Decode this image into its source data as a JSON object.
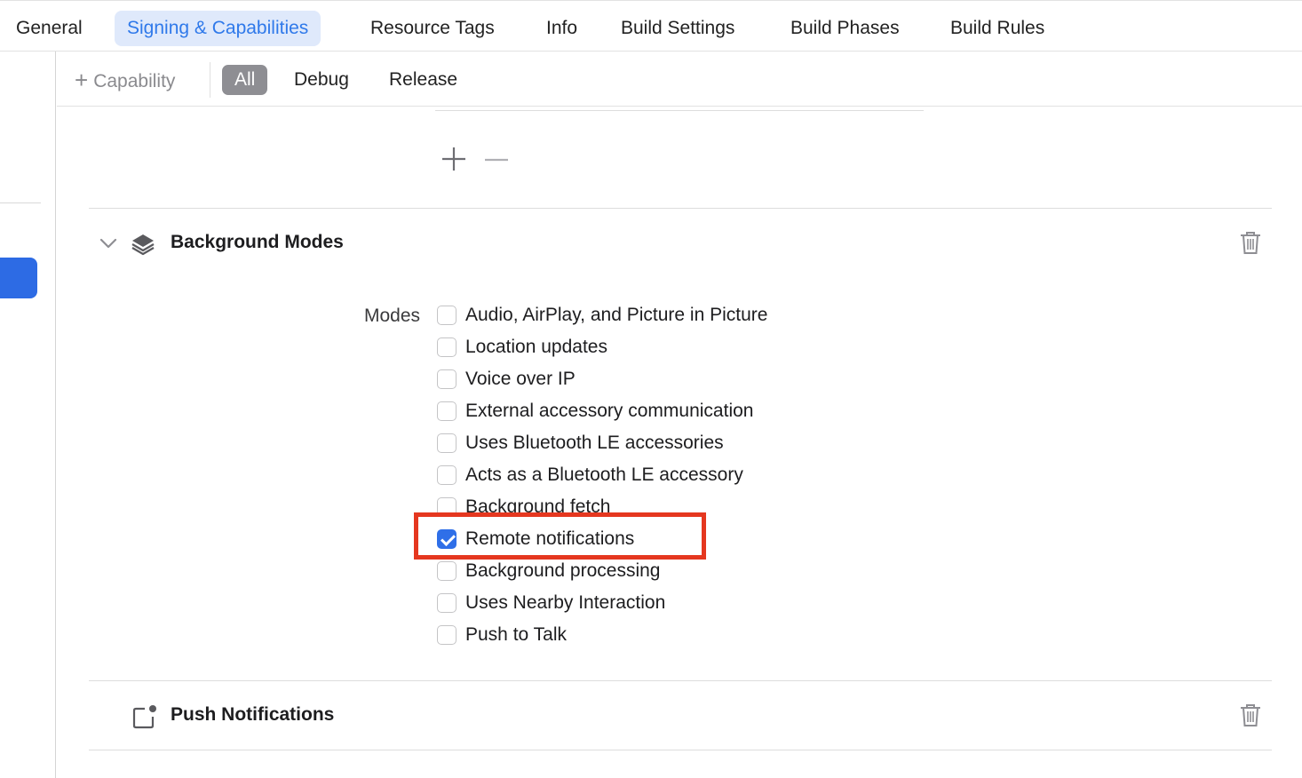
{
  "tabs": [
    {
      "label": "General",
      "active": false
    },
    {
      "label": "Signing & Capabilities",
      "active": true
    },
    {
      "label": "Resource Tags",
      "active": false
    },
    {
      "label": "Info",
      "active": false
    },
    {
      "label": "Build Settings",
      "active": false
    },
    {
      "label": "Build Phases",
      "active": false
    },
    {
      "label": "Build Rules",
      "active": false
    }
  ],
  "filter_bar": {
    "add_capability_label": "Capability",
    "segments": [
      {
        "label": "All",
        "selected": true
      },
      {
        "label": "Debug",
        "selected": false
      },
      {
        "label": "Release",
        "selected": false
      }
    ]
  },
  "background_modes": {
    "title": "Background Modes",
    "modes_label": "Modes",
    "modes": [
      {
        "label": "Audio, AirPlay, and Picture in Picture",
        "checked": false
      },
      {
        "label": "Location updates",
        "checked": false
      },
      {
        "label": "Voice over IP",
        "checked": false
      },
      {
        "label": "External accessory communication",
        "checked": false
      },
      {
        "label": "Uses Bluetooth LE accessories",
        "checked": false
      },
      {
        "label": "Acts as a Bluetooth LE accessory",
        "checked": false
      },
      {
        "label": "Background fetch",
        "checked": false
      },
      {
        "label": "Remote notifications",
        "checked": true
      },
      {
        "label": "Background processing",
        "checked": false
      },
      {
        "label": "Uses Nearby Interaction",
        "checked": false
      },
      {
        "label": "Push to Talk",
        "checked": false
      }
    ]
  },
  "push_notifications": {
    "title": "Push Notifications"
  },
  "icons": {
    "add": "plus-icon",
    "remove": "minus-icon",
    "disclosure": "chevron-down-icon",
    "background_modes": "layers-icon",
    "push_notifications": "notification-badge-icon",
    "delete": "trash-icon"
  },
  "colors": {
    "accent": "#2f6fe8",
    "active_tab_bg": "#dfe9fb",
    "active_tab_text": "#2f79ea",
    "highlight": "#e5371f",
    "segment_selected_bg": "#8e8e93"
  }
}
